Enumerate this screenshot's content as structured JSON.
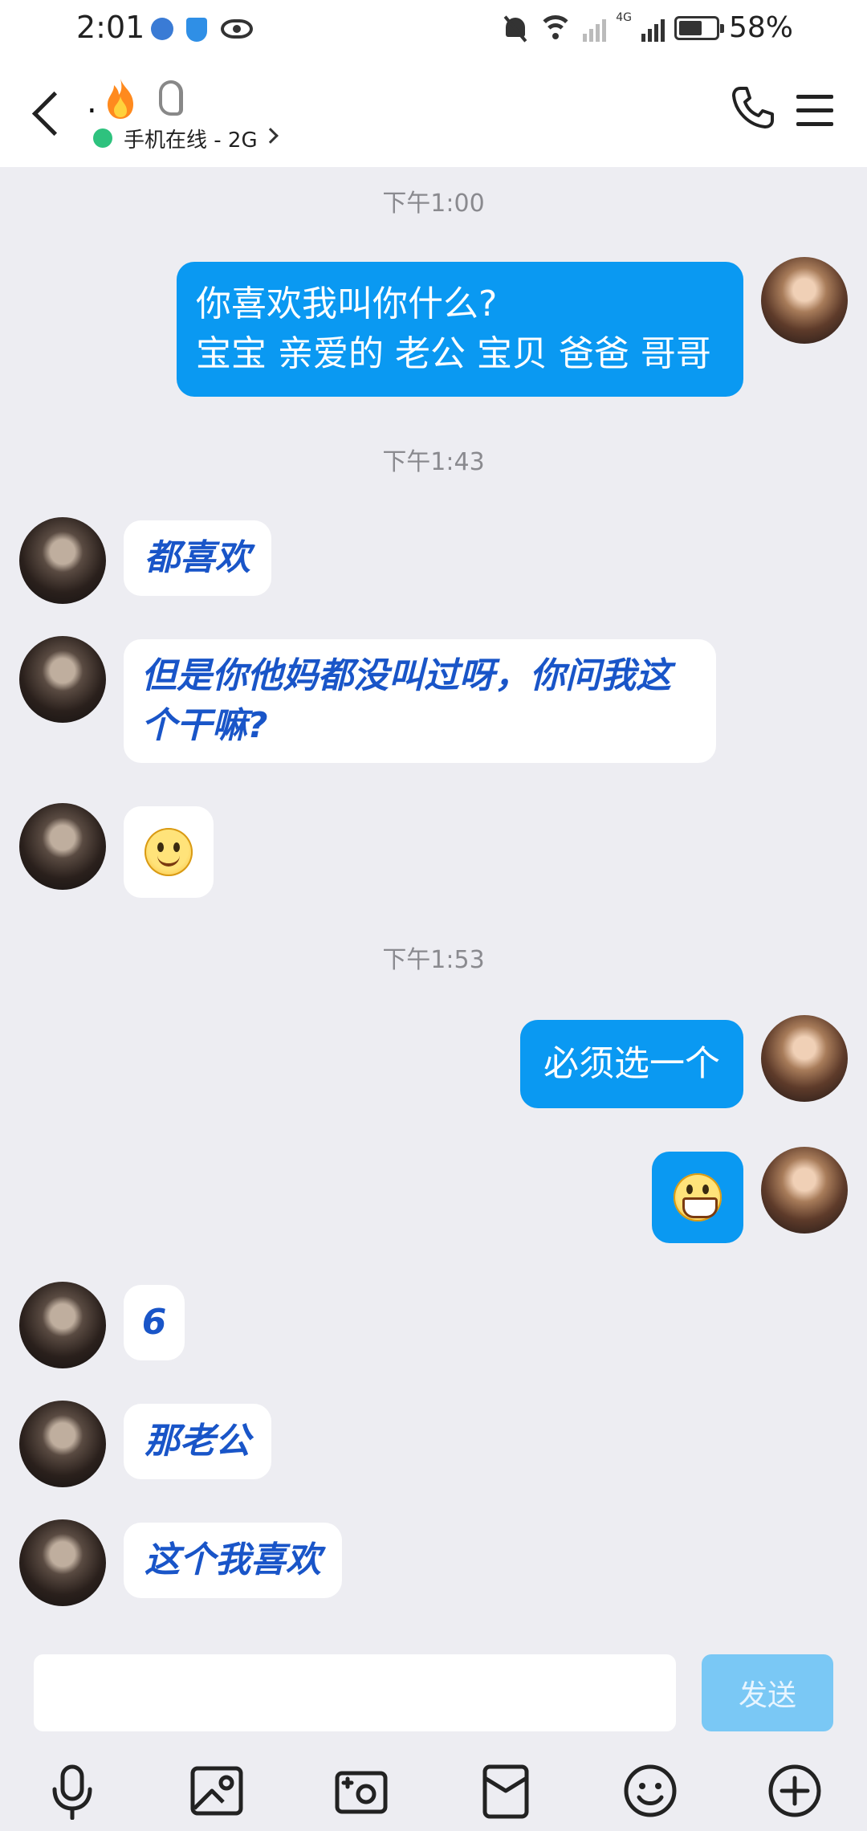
{
  "status_bar": {
    "time": "2:01",
    "network": "4G",
    "battery": "58%"
  },
  "header": {
    "contact_name": ".",
    "online_status": "手机在线 - 2G",
    "status_color": "#2ec27e"
  },
  "icons": {
    "back": "back-icon",
    "flame": "flame-icon",
    "ear": "ear-icon",
    "phone": "phone-icon",
    "menu": "menu-icon",
    "voice": "microphone-icon",
    "photo": "image-icon",
    "camera": "camera-icon",
    "red_packet": "red-packet-icon",
    "emoji": "emoji-icon",
    "more": "plus-circle-icon"
  },
  "colors": {
    "my_bubble": "#0a99f2",
    "their_text": "#1955c8",
    "background": "#ededf2",
    "send_disabled": "#7ac8f5"
  },
  "timestamps": [
    "下午1:00",
    "下午1:43",
    "下午1:53"
  ],
  "messages": [
    {
      "from": "me",
      "lines": [
        "你喜欢我叫你什么?",
        "宝宝 亲爱的 老公 宝贝 爸爸 哥哥"
      ]
    },
    {
      "from": "them",
      "text": "都喜欢"
    },
    {
      "from": "them",
      "lines": [
        "但是你他妈都没叫过呀，你问我这",
        "个干嘛?"
      ]
    },
    {
      "from": "them",
      "emoji": "smile-emoji"
    },
    {
      "from": "me",
      "text": "必须选一个"
    },
    {
      "from": "me",
      "emoji": "grin-emoji"
    },
    {
      "from": "them",
      "text": "6"
    },
    {
      "from": "them",
      "text": "那老公"
    },
    {
      "from": "them",
      "text": "这个我喜欢"
    }
  ],
  "input": {
    "value": "",
    "placeholder": "",
    "send_label": "发送"
  }
}
